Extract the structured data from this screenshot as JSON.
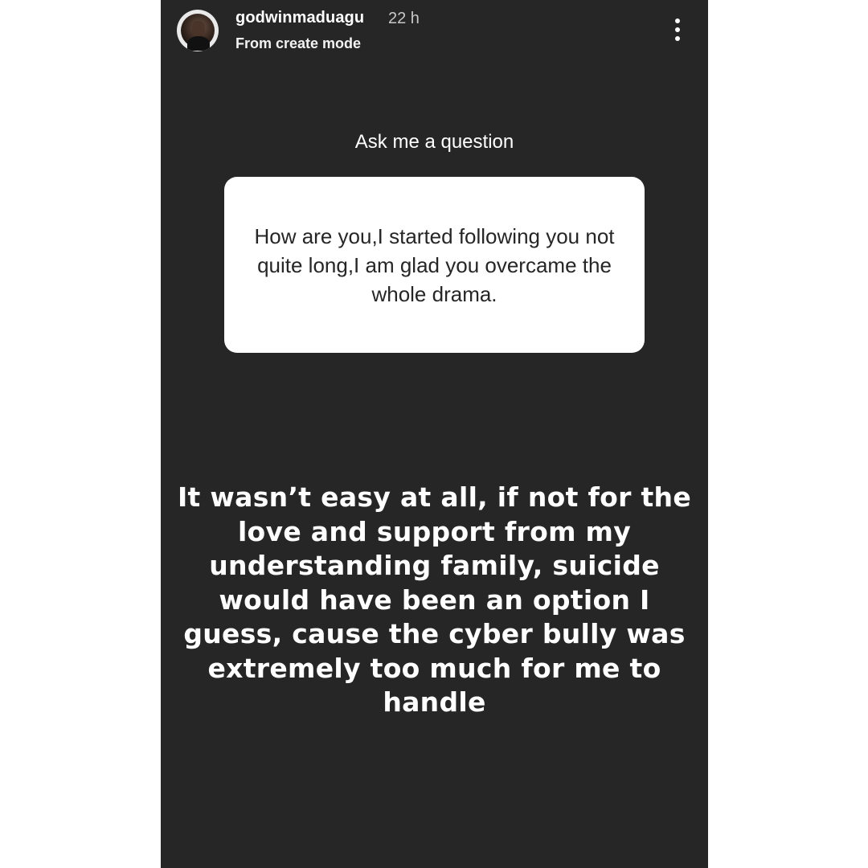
{
  "story": {
    "header": {
      "username": "godwinmaduagu",
      "timestamp": "22 h",
      "subtitle": "From create mode",
      "avatar_icon": "profile-avatar",
      "more_icon": "more-vertical-icon"
    },
    "question_sticker": {
      "title": "Ask me a question",
      "question_text": "How are you,I started following you not quite long,I am glad you overcame the whole drama."
    },
    "answer_text": "It wasn’t easy at all, if not for the love and support from my understanding family, suicide would have been an option I guess, cause the cyber bully was extremely too much for me to handle"
  },
  "colors": {
    "story_background": "#262626",
    "page_background": "#ffffff",
    "card_background": "#ffffff",
    "text_primary": "#ffffff",
    "card_text": "#262626"
  }
}
